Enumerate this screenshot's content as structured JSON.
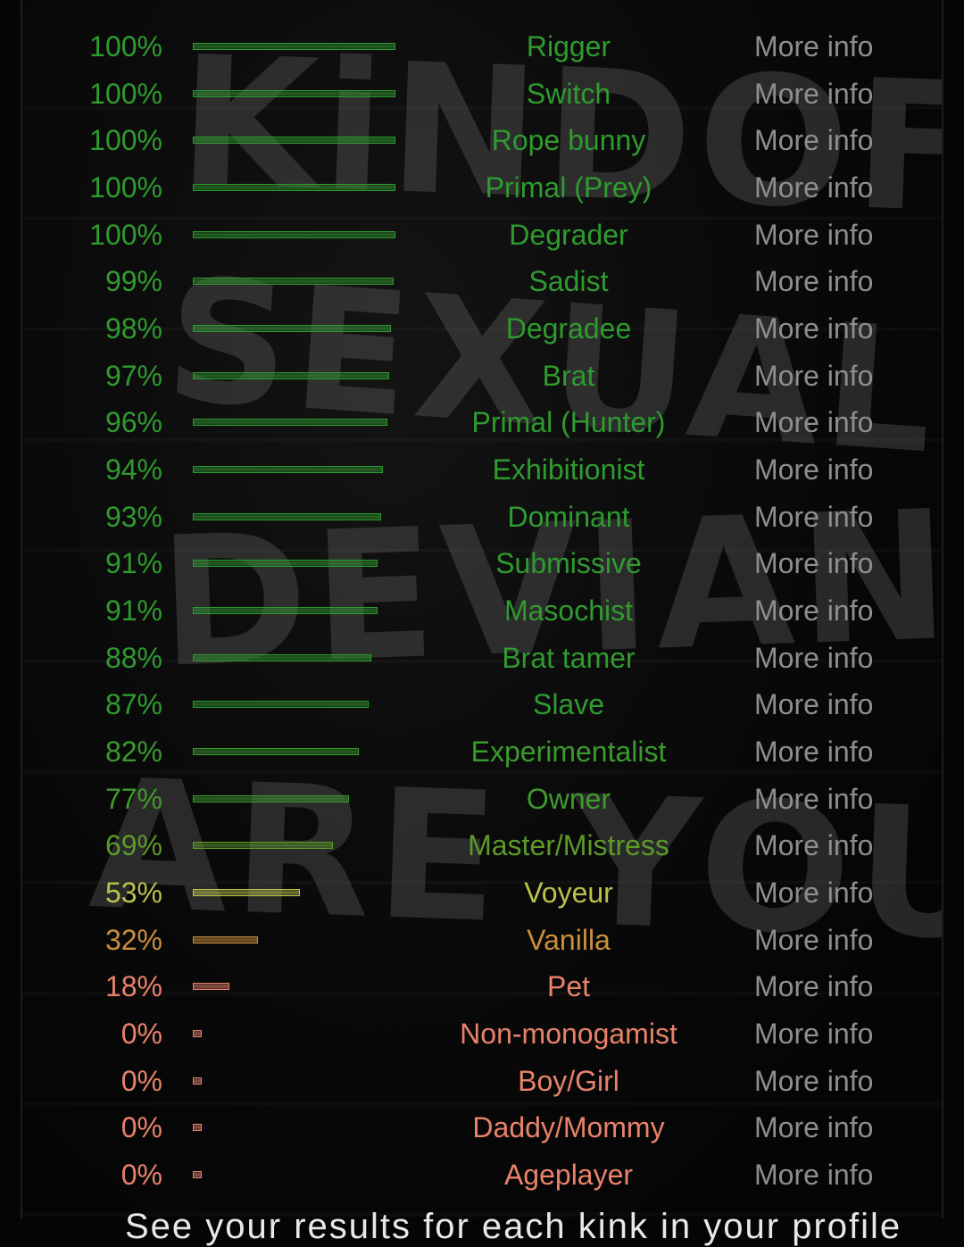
{
  "background_watermark": [
    "KiNDOF",
    "SEXUAL",
    "DEVIANT",
    "ARE YOU"
  ],
  "more_info_label": "More info",
  "colors": {
    "green": "#2f9b2f",
    "olive_green": "#5c9a2a",
    "yellow_green": "#b9c34a",
    "orange": "#c98f3a",
    "salmon": "#e8826a",
    "more_info_gray": "#8e8e8e"
  },
  "results": [
    {
      "percent": 100,
      "label": "100%",
      "name": "Rigger",
      "color": "#2f9b2f"
    },
    {
      "percent": 100,
      "label": "100%",
      "name": "Switch",
      "color": "#2f9b2f"
    },
    {
      "percent": 100,
      "label": "100%",
      "name": "Rope bunny",
      "color": "#2f9b2f"
    },
    {
      "percent": 100,
      "label": "100%",
      "name": "Primal (Prey)",
      "color": "#2f9b2f"
    },
    {
      "percent": 100,
      "label": "100%",
      "name": "Degrader",
      "color": "#2f9b2f"
    },
    {
      "percent": 99,
      "label": "99%",
      "name": "Sadist",
      "color": "#2f9b2f"
    },
    {
      "percent": 98,
      "label": "98%",
      "name": "Degradee",
      "color": "#2f9b2f"
    },
    {
      "percent": 97,
      "label": "97%",
      "name": "Brat",
      "color": "#2f9b2f"
    },
    {
      "percent": 96,
      "label": "96%",
      "name": "Primal (Hunter)",
      "color": "#2f9b2f"
    },
    {
      "percent": 94,
      "label": "94%",
      "name": "Exhibitionist",
      "color": "#2f9b2f"
    },
    {
      "percent": 93,
      "label": "93%",
      "name": "Dominant",
      "color": "#2f9b2f"
    },
    {
      "percent": 91,
      "label": "91%",
      "name": "Submissive",
      "color": "#2f9b2f"
    },
    {
      "percent": 91,
      "label": "91%",
      "name": "Masochist",
      "color": "#2f9b2f"
    },
    {
      "percent": 88,
      "label": "88%",
      "name": "Brat tamer",
      "color": "#2f9b2f"
    },
    {
      "percent": 87,
      "label": "87%",
      "name": "Slave",
      "color": "#2f9b2f"
    },
    {
      "percent": 82,
      "label": "82%",
      "name": "Experimentalist",
      "color": "#3a9a2e"
    },
    {
      "percent": 77,
      "label": "77%",
      "name": "Owner",
      "color": "#3f9a2c"
    },
    {
      "percent": 69,
      "label": "69%",
      "name": "Master/Mistress",
      "color": "#5c9a2a"
    },
    {
      "percent": 53,
      "label": "53%",
      "name": "Voyeur",
      "color": "#b9c34a"
    },
    {
      "percent": 32,
      "label": "32%",
      "name": "Vanilla",
      "color": "#c98f3a"
    },
    {
      "percent": 18,
      "label": "18%",
      "name": "Pet",
      "color": "#e8826a"
    },
    {
      "percent": 0,
      "label": "0%",
      "name": "Non-monogamist",
      "color": "#e8826a"
    },
    {
      "percent": 0,
      "label": "0%",
      "name": "Boy/Girl",
      "color": "#e8826a"
    },
    {
      "percent": 0,
      "label": "0%",
      "name": "Daddy/Mommy",
      "color": "#e8826a"
    },
    {
      "percent": 0,
      "label": "0%",
      "name": "Ageplayer",
      "color": "#e8826a"
    }
  ],
  "footer_partial_text": "See your results for each kink in your profile"
}
